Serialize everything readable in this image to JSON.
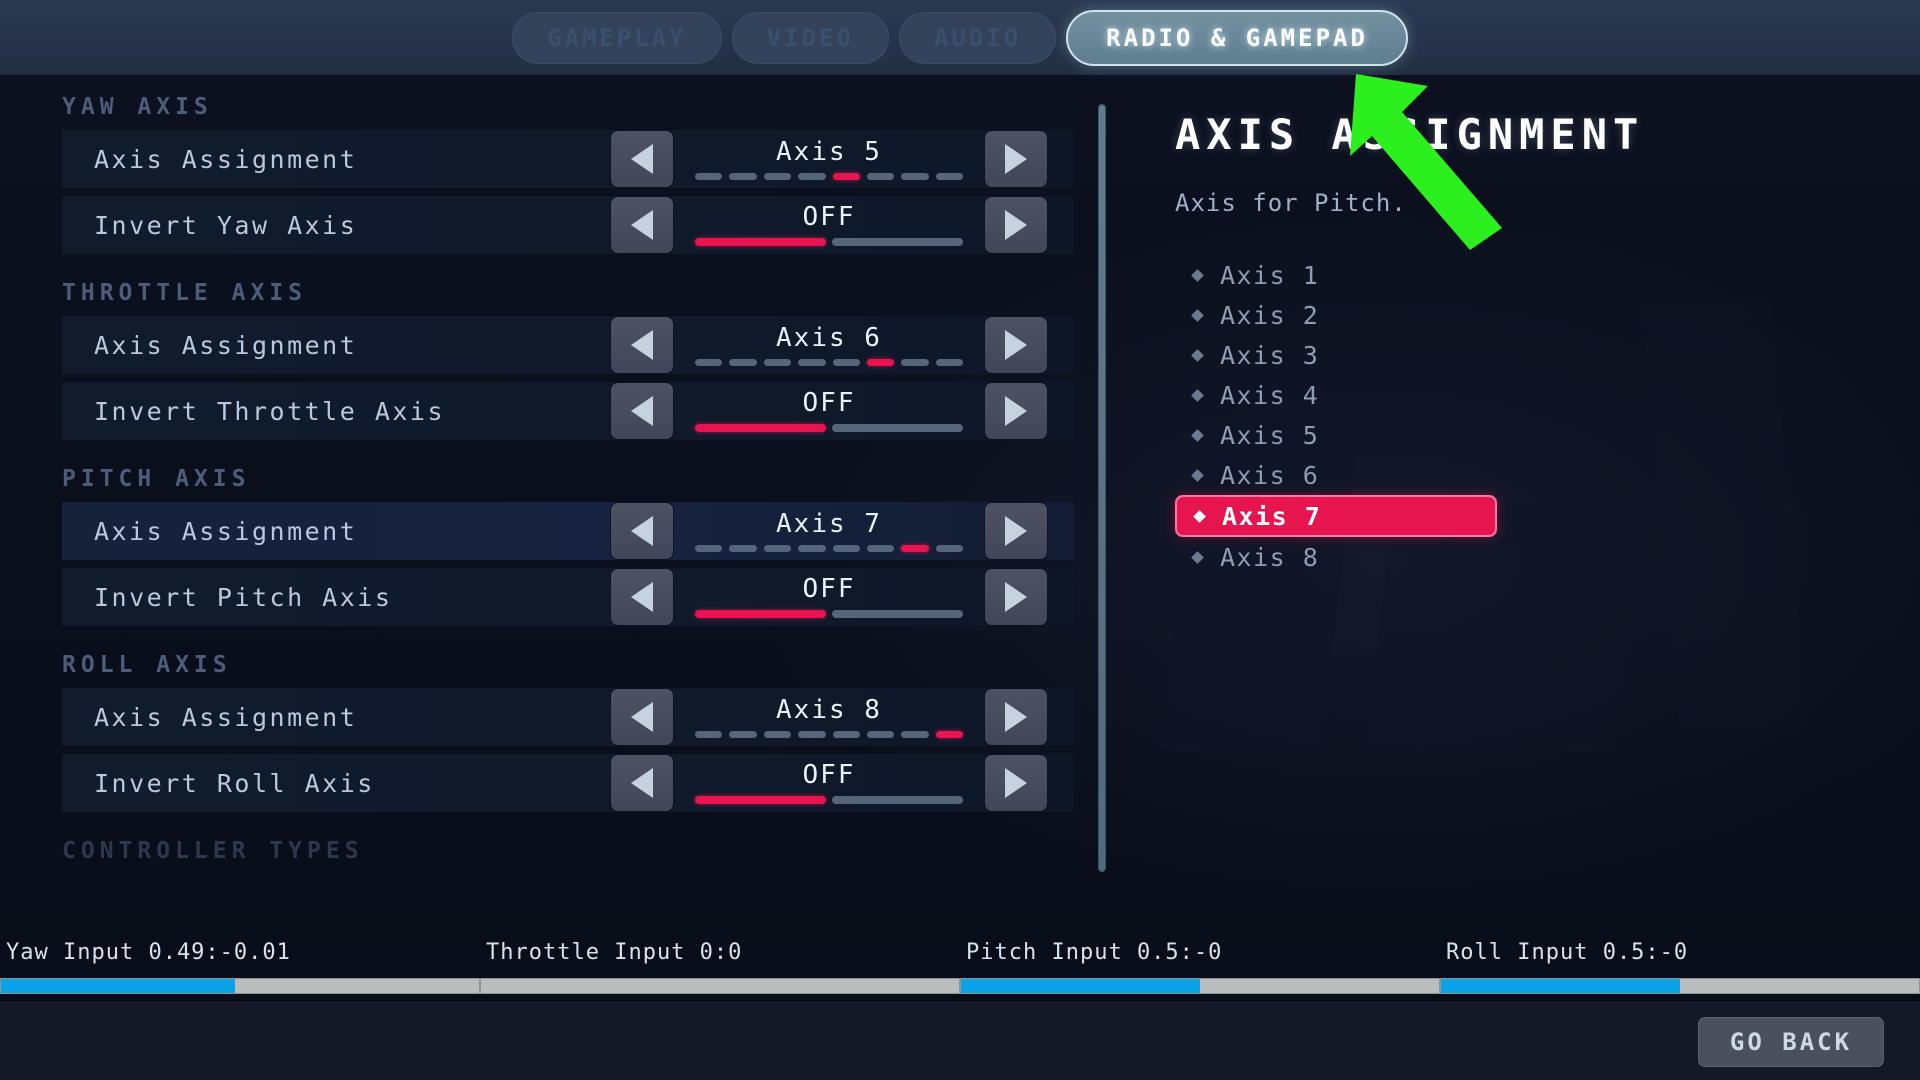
{
  "tabs": [
    {
      "label": "GAMEPLAY",
      "active": false
    },
    {
      "label": "VIDEO",
      "active": false
    },
    {
      "label": "AUDIO",
      "active": false
    },
    {
      "label": "RADIO & GAMEPAD",
      "active": true
    }
  ],
  "settings": {
    "sections": [
      {
        "title": "YAW AXIS",
        "rows": [
          {
            "label": "Axis Assignment",
            "value": "Axis 5",
            "type": "segmented",
            "segments": 8,
            "active_index": 5,
            "focused": false
          },
          {
            "label": "Invert Yaw Axis",
            "value": "OFF",
            "type": "binary",
            "segments": 2,
            "active_index": 1,
            "focused": false
          }
        ]
      },
      {
        "title": "THROTTLE AXIS",
        "rows": [
          {
            "label": "Axis Assignment",
            "value": "Axis 6",
            "type": "segmented",
            "segments": 8,
            "active_index": 6,
            "focused": false
          },
          {
            "label": "Invert Throttle Axis",
            "value": "OFF",
            "type": "binary",
            "segments": 2,
            "active_index": 1,
            "focused": false
          }
        ]
      },
      {
        "title": "PITCH AXIS",
        "rows": [
          {
            "label": "Axis Assignment",
            "value": "Axis 7",
            "type": "segmented",
            "segments": 8,
            "active_index": 7,
            "focused": true
          },
          {
            "label": "Invert Pitch Axis",
            "value": "OFF",
            "type": "binary",
            "segments": 2,
            "active_index": 1,
            "focused": false
          }
        ]
      },
      {
        "title": "ROLL AXIS",
        "rows": [
          {
            "label": "Axis Assignment",
            "value": "Axis 8",
            "type": "segmented",
            "segments": 8,
            "active_index": 8,
            "focused": false
          },
          {
            "label": "Invert Roll Axis",
            "value": "OFF",
            "type": "binary",
            "segments": 2,
            "active_index": 1,
            "focused": false
          }
        ]
      },
      {
        "title": "CONTROLLER TYPES",
        "rows": []
      }
    ],
    "arrow_left_icon": "triangle-left-icon",
    "arrow_right_icon": "triangle-right-icon"
  },
  "info_panel": {
    "title": "AXIS ASSIGNMENT",
    "description": "Axis for Pitch.",
    "options": [
      {
        "label": "Axis 1",
        "selected": false
      },
      {
        "label": "Axis 2",
        "selected": false
      },
      {
        "label": "Axis 3",
        "selected": false
      },
      {
        "label": "Axis 4",
        "selected": false
      },
      {
        "label": "Axis 5",
        "selected": false
      },
      {
        "label": "Axis 6",
        "selected": false
      },
      {
        "label": "Axis 7",
        "selected": true
      },
      {
        "label": "Axis 8",
        "selected": false
      }
    ]
  },
  "meters": [
    {
      "label": "Yaw Input 0.49:-0.01",
      "fill_percent": 49
    },
    {
      "label": "Throttle Input 0:0",
      "fill_percent": 0
    },
    {
      "label": "Pitch Input 0.5:-0",
      "fill_percent": 50
    },
    {
      "label": "Roll Input 0.5:-0",
      "fill_percent": 50
    }
  ],
  "bottom_bar": {
    "go_back_label": "GO BACK"
  },
  "colors": {
    "accent_pink": "#e6144f",
    "meter_blue": "#09a1e8",
    "pointer_green": "#2bf01e",
    "panel_bg": "#0c1120"
  }
}
